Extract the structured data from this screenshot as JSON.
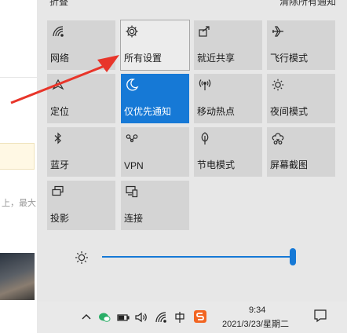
{
  "header": {
    "collapse_label": "折叠",
    "clear_label": "清除所有通知"
  },
  "tiles": [
    {
      "label": "网络",
      "icon": "network-icon",
      "active": false
    },
    {
      "label": "所有设置",
      "icon": "gear-icon",
      "active": false,
      "hover": true
    },
    {
      "label": "就近共享",
      "icon": "share-icon",
      "active": false
    },
    {
      "label": "飞行模式",
      "icon": "airplane-icon",
      "active": false
    },
    {
      "label": "定位",
      "icon": "location-icon",
      "active": false
    },
    {
      "label": "仅优先通知",
      "icon": "moon-icon",
      "active": true
    },
    {
      "label": "移动热点",
      "icon": "hotspot-icon",
      "active": false
    },
    {
      "label": "夜间模式",
      "icon": "brightness-icon",
      "active": false
    },
    {
      "label": "蓝牙",
      "icon": "bluetooth-icon",
      "active": false
    },
    {
      "label": "VPN",
      "icon": "vpn-icon",
      "active": false
    },
    {
      "label": "节电模式",
      "icon": "leaf-icon",
      "active": false
    },
    {
      "label": "屏幕截图",
      "icon": "screenshot-icon",
      "active": false
    },
    {
      "label": "投影",
      "icon": "project-icon",
      "active": false
    },
    {
      "label": "连接",
      "icon": "connect-icon",
      "active": false
    }
  ],
  "brightness": {
    "level_percent": 100,
    "icon": "sun-icon"
  },
  "taskbar": {
    "time": "9:34",
    "date": "2021/3/23/星期二",
    "tray_icons": [
      "chevron-up-icon",
      "wechat-icon",
      "battery-icon",
      "volume-icon",
      "wifi-icon",
      "ime-icon",
      "sogou-icon"
    ]
  },
  "background": {
    "partial_text": "上，最大"
  },
  "colors": {
    "accent": "#1679d6",
    "tile": "#d4d4d4",
    "panel": "#e7e7e7",
    "annotation": "#e8352a"
  }
}
